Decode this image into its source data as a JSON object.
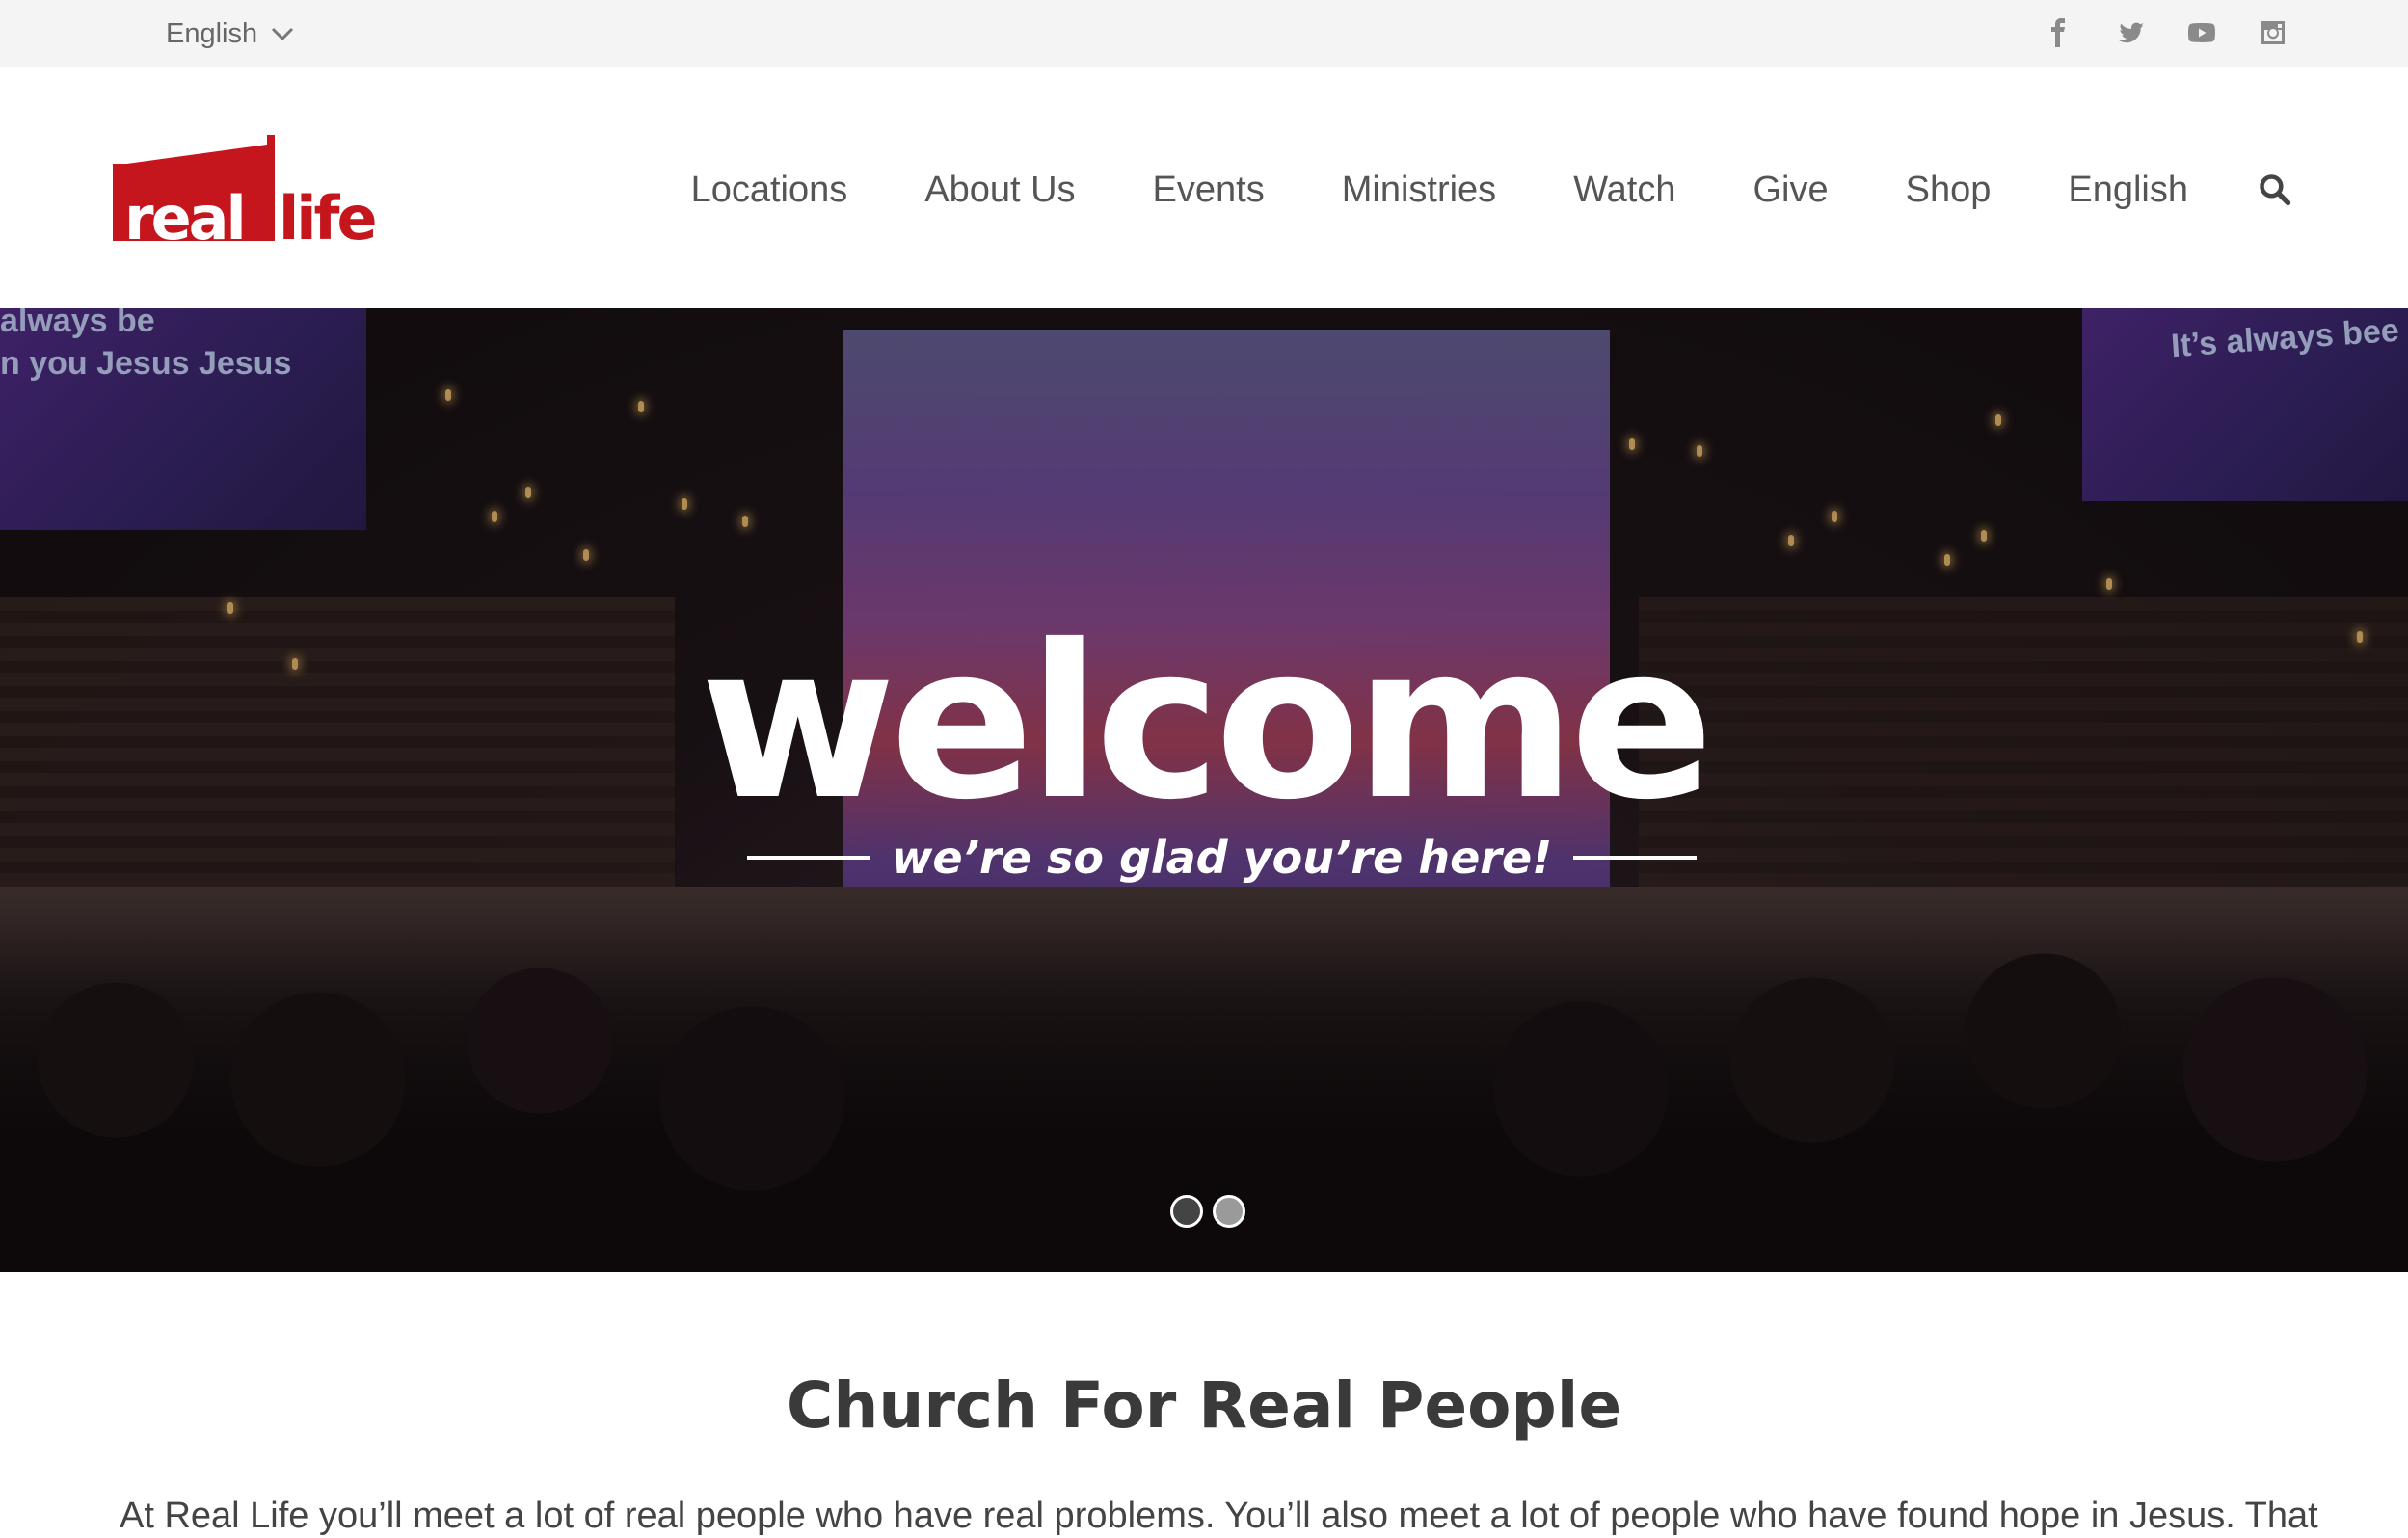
{
  "topbar": {
    "language": "English",
    "socials": [
      {
        "icon": "facebook-icon"
      },
      {
        "icon": "twitter-icon"
      },
      {
        "icon": "youtube-icon"
      },
      {
        "icon": "instagram-icon"
      }
    ]
  },
  "header": {
    "logo_text": "real life",
    "brand_color": "#c4161c",
    "nav": [
      "Locations",
      "About Us",
      "Events",
      "Ministries",
      "Watch",
      "Give",
      "Shop",
      "English"
    ]
  },
  "hero": {
    "title": "welcome",
    "subtitle": "we’re so glad you’re here!",
    "screen_left_lines": [
      "always be",
      "n you Jesus Jesus"
    ],
    "screen_right_text": "It’s always bee",
    "slides": 2,
    "active_slide": 1
  },
  "content": {
    "title": "Church For Real People",
    "body": "At Real Life you’ll meet a lot of real people who have real problems. You’ll also meet a lot of people who have found hope in Jesus. That"
  }
}
